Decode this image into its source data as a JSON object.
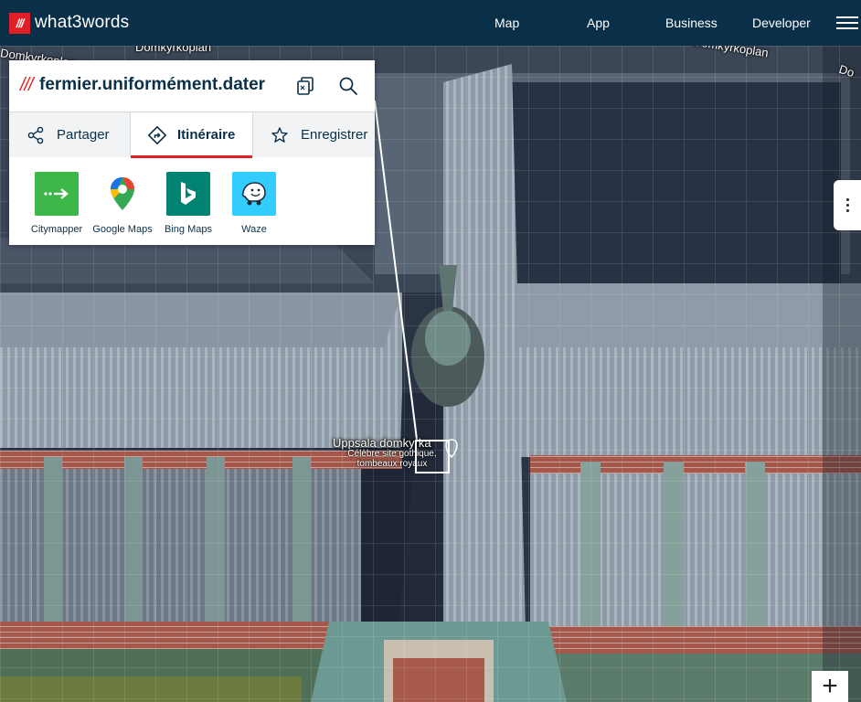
{
  "header": {
    "logo_mark": "///",
    "logo_text": "what3words",
    "nav": [
      "Map",
      "App",
      "Business",
      "Developer"
    ]
  },
  "card": {
    "address_prefix": "///",
    "address": "fermier.uniformément.dater",
    "tabs": [
      {
        "label": "Partager",
        "icon": "share-icon"
      },
      {
        "label": "Itinéraire",
        "icon": "directions-icon",
        "active": true
      },
      {
        "label": "Enregistrer",
        "icon": "star-icon"
      }
    ],
    "apps": [
      {
        "label": "Citymapper",
        "icon": "citymapper-icon",
        "color": "#3db64a"
      },
      {
        "label": "Google Maps",
        "icon": "google-maps-icon",
        "color": "#ffffff"
      },
      {
        "label": "Bing Maps",
        "icon": "bing-maps-icon",
        "color": "#008373"
      },
      {
        "label": "Waze",
        "icon": "waze-icon",
        "color": "#33ccff"
      }
    ]
  },
  "map": {
    "road_labels": [
      "Domkyrkoplan",
      "Domkyrkoplan",
      "Domkyrkoplan",
      "Domkyrkoplan",
      "Do"
    ],
    "poi": {
      "title": "Uppsala domkyrka",
      "subtitle": "Célèbre site gothique, tombeaux royaux"
    },
    "zoom_in_label": "+"
  },
  "colors": {
    "brand_red": "#e11f26",
    "brand_navy": "#0a3049"
  }
}
